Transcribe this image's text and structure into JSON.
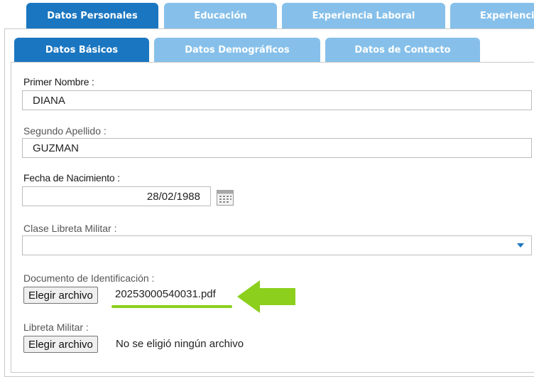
{
  "tabs": [
    {
      "label": "Datos Personales",
      "active": true
    },
    {
      "label": "Educación",
      "active": false
    },
    {
      "label": "Experiencia Laboral",
      "active": false
    },
    {
      "label": "Experienci",
      "active": false
    }
  ],
  "subtabs": [
    {
      "label": "Datos Básicos",
      "active": true
    },
    {
      "label": "Datos Demográficos",
      "active": false
    },
    {
      "label": "Datos de Contacto",
      "active": false
    }
  ],
  "form": {
    "primer_nombre": {
      "label": "Primer Nombre :",
      "value": "DIANA"
    },
    "segundo_apellido": {
      "label": "Segundo Apellido :",
      "value": "GUZMAN"
    },
    "fecha_nacimiento": {
      "label": "Fecha de Nacimiento :",
      "value": "28/02/1988"
    },
    "clase_libreta": {
      "label": "Clase Libreta Militar :",
      "value": ""
    },
    "documento": {
      "label": "Documento de Identificación :",
      "button": "Elegir archivo",
      "file": "20253000540031.pdf"
    },
    "libreta": {
      "label": "Libreta Militar :",
      "button": "Elegir archivo",
      "file": "No se eligió ningún archivo"
    }
  },
  "colors": {
    "active_tab": "#1a76c0",
    "inactive_tab": "#86c0ea",
    "highlight": "#8ccf1d"
  },
  "icons": {
    "calendar": "calendar-icon",
    "dropdown": "chevron-down-icon",
    "arrow": "arrow-left-icon"
  }
}
